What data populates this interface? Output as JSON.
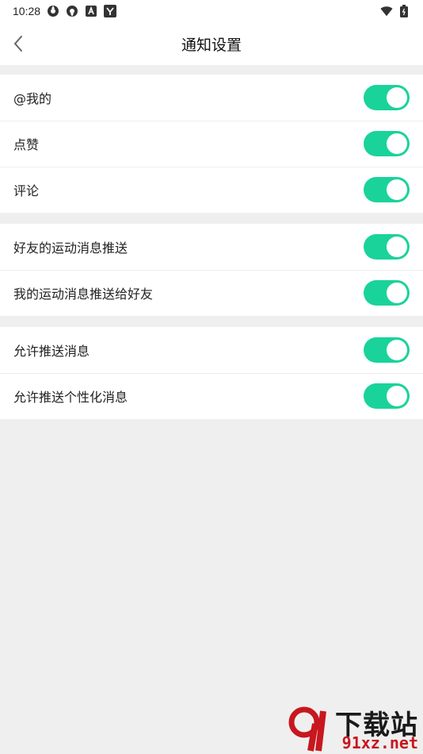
{
  "status_bar": {
    "time": "10:28",
    "icons": [
      "app-icon-1",
      "app-icon-2",
      "a-icon",
      "y-icon"
    ],
    "right_icons": [
      "wifi-icon",
      "battery-icon"
    ]
  },
  "header": {
    "title": "通知设置",
    "back_icon": "chevron-left-icon"
  },
  "sections": [
    {
      "items": [
        {
          "label": "@我的",
          "enabled": true
        },
        {
          "label": "点赞",
          "enabled": true
        },
        {
          "label": "评论",
          "enabled": true
        }
      ]
    },
    {
      "items": [
        {
          "label": "好友的运动消息推送",
          "enabled": true
        },
        {
          "label": "我的运动消息推送给好友",
          "enabled": true
        }
      ]
    },
    {
      "items": [
        {
          "label": "允许推送消息",
          "enabled": true
        },
        {
          "label": "允许推送个性化消息",
          "enabled": true
        }
      ]
    }
  ],
  "watermark": {
    "main": "下载站",
    "sub": "91xz.net"
  },
  "colors": {
    "accent": "#19d39a",
    "background": "#efefef",
    "surface": "#ffffff"
  }
}
